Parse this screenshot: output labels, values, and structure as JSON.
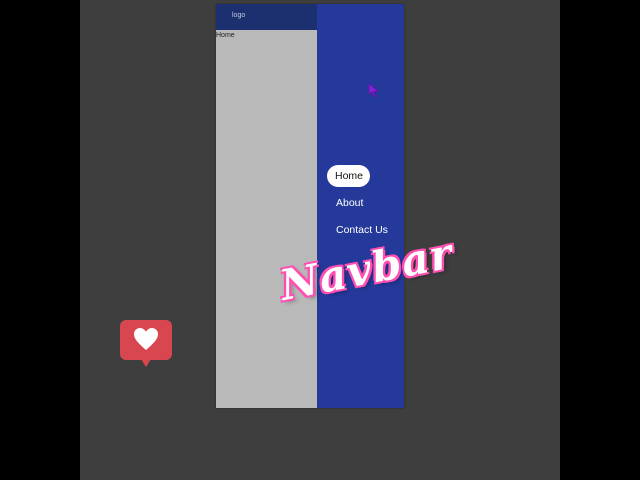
{
  "phone": {
    "logo": "logo",
    "breadcrumb": "Home"
  },
  "drawer": {
    "items": [
      {
        "label": "Home",
        "active": true
      },
      {
        "label": "About",
        "active": false
      },
      {
        "label": "Contact Us",
        "active": false
      }
    ]
  },
  "overlay": {
    "title": "Navbar"
  },
  "icons": {
    "cursor": "cursor-arrow-icon",
    "like": "heart-icon"
  },
  "colors": {
    "drawer": "#24399a",
    "header": "#1c2f6e",
    "content": "#b9b9b9",
    "title_outline": "#ff4fb3",
    "like_badge": "#d8464f"
  }
}
